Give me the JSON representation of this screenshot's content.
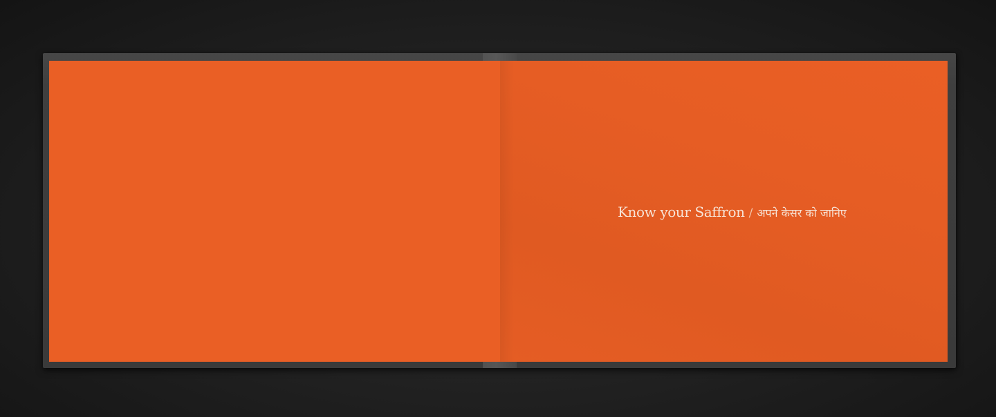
{
  "book": {
    "title_en": "Know your Saffron",
    "separator": "/",
    "title_hi": "अपने केसर को जानिए"
  },
  "colors": {
    "page": "#ea5f25",
    "cover": "#3a3a3a",
    "background": "#1c1c1c",
    "text": "#f7e3d6"
  }
}
